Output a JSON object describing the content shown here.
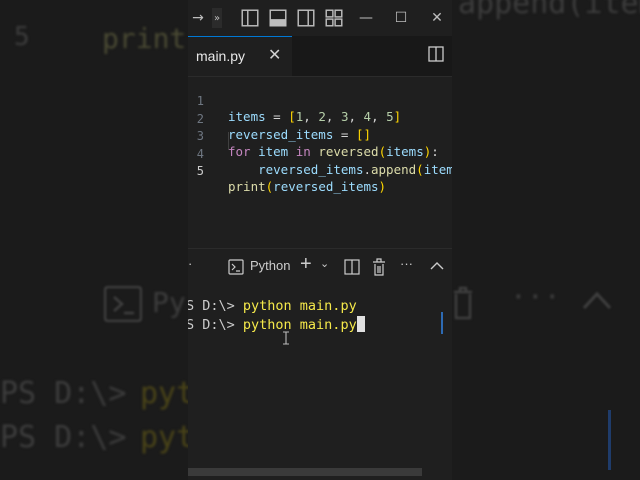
{
  "editor": {
    "tab": {
      "filename": "main.py"
    },
    "lines": [
      {
        "num": "1",
        "text": "items = [1, 2, 3, 4, 5]"
      },
      {
        "num": "2",
        "text": "reversed_items = []"
      },
      {
        "num": "3",
        "text": "for item in reversed(items):"
      },
      {
        "num": "4",
        "text": "    reversed_items.append(item)"
      },
      {
        "num": "5",
        "text": "print(reversed_items)"
      }
    ],
    "active_line": "5"
  },
  "panel": {
    "terminal_name": "Python",
    "prompt": "PS D:\\> ",
    "command": "python main.py",
    "prompt_visible": "S D:\\> "
  },
  "background": {
    "line_number": "5",
    "code_fragment": "print",
    "code_fragment_tail": "append(item",
    "terminal_fragment_1": "PS D:\\> ",
    "terminal_fragment_2": "PS D:\\> ",
    "cmd_fragment": "pyt",
    "panel_label": "Py"
  },
  "colors": {
    "accent": "#0078d4",
    "command": "#f5e94a",
    "keyword": "#c586c0",
    "function": "#dcdcaa",
    "number": "#b5cea8"
  }
}
